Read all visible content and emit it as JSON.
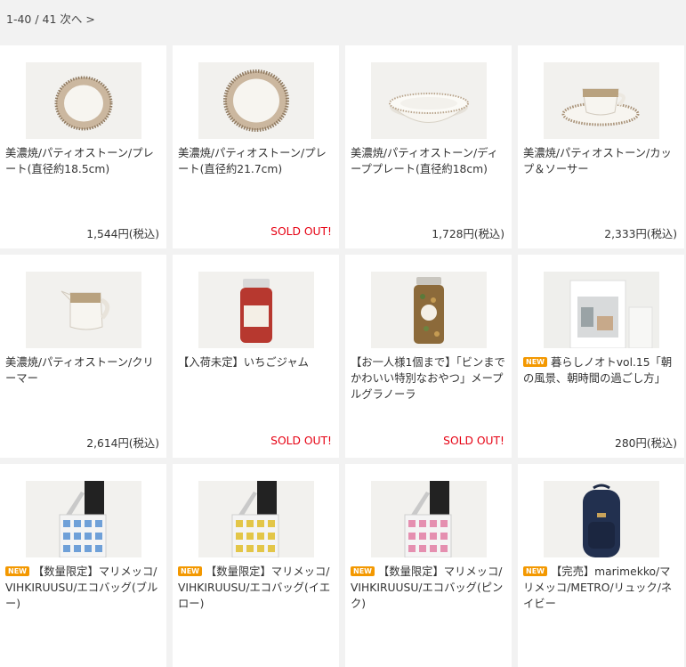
{
  "pager": {
    "text": "1-40 / 41 次へ >"
  },
  "badge_new": "NEW",
  "products": [
    {
      "name": "美濃焼/パティオストーン/プレート(直径約18.5cm)",
      "price": "1,544円(税込)",
      "sold": false,
      "new": false,
      "image": "plate-small-image"
    },
    {
      "name": "美濃焼/パティオストーン/プレート(直径約21.7cm)",
      "price": "SOLD OUT!",
      "sold": true,
      "new": false,
      "image": "plate-large-image"
    },
    {
      "name": "美濃焼/パティオストーン/ディーププレート(直径約18cm)",
      "price": "1,728円(税込)",
      "sold": false,
      "new": false,
      "image": "deep-plate-image"
    },
    {
      "name": "美濃焼/パティオストーン/カップ＆ソーサー",
      "price": "2,333円(税込)",
      "sold": false,
      "new": false,
      "image": "cup-saucer-image"
    },
    {
      "name": "美濃焼/パティオストーン/クリーマー",
      "price": "2,614円(税込)",
      "sold": false,
      "new": false,
      "image": "creamer-image"
    },
    {
      "name": "【入荷未定】いちごジャム",
      "price": "SOLD OUT!",
      "sold": true,
      "new": false,
      "image": "jam-jar-image"
    },
    {
      "name": "【お一人様1個まで】「ビンまでかわいい特別なおやつ」メープルグラノーラ",
      "price": "SOLD OUT!",
      "sold": true,
      "new": false,
      "image": "granola-jar-image"
    },
    {
      "name": "暮らしノオトvol.15「朝の風景、朝時間の過ごし方」",
      "price": "280円(税込)",
      "sold": false,
      "new": true,
      "image": "magazine-image"
    },
    {
      "name": "【数量限定】マリメッコ/VIHKIRUUSU/エコバッグ(ブルー)",
      "price": "",
      "sold": false,
      "new": true,
      "image": "ecobag-blue-image"
    },
    {
      "name": "【数量限定】マリメッコ/VIHKIRUUSU/エコバッグ(イエロー)",
      "price": "",
      "sold": false,
      "new": true,
      "image": "ecobag-yellow-image"
    },
    {
      "name": "【数量限定】マリメッコ/VIHKIRUUSU/エコバッグ(ピンク)",
      "price": "",
      "sold": false,
      "new": true,
      "image": "ecobag-pink-image"
    },
    {
      "name": "【完売】marimekko/マリメッコ/METRO/リュック/ネイビー",
      "price": "",
      "sold": false,
      "new": true,
      "image": "backpack-image"
    }
  ]
}
